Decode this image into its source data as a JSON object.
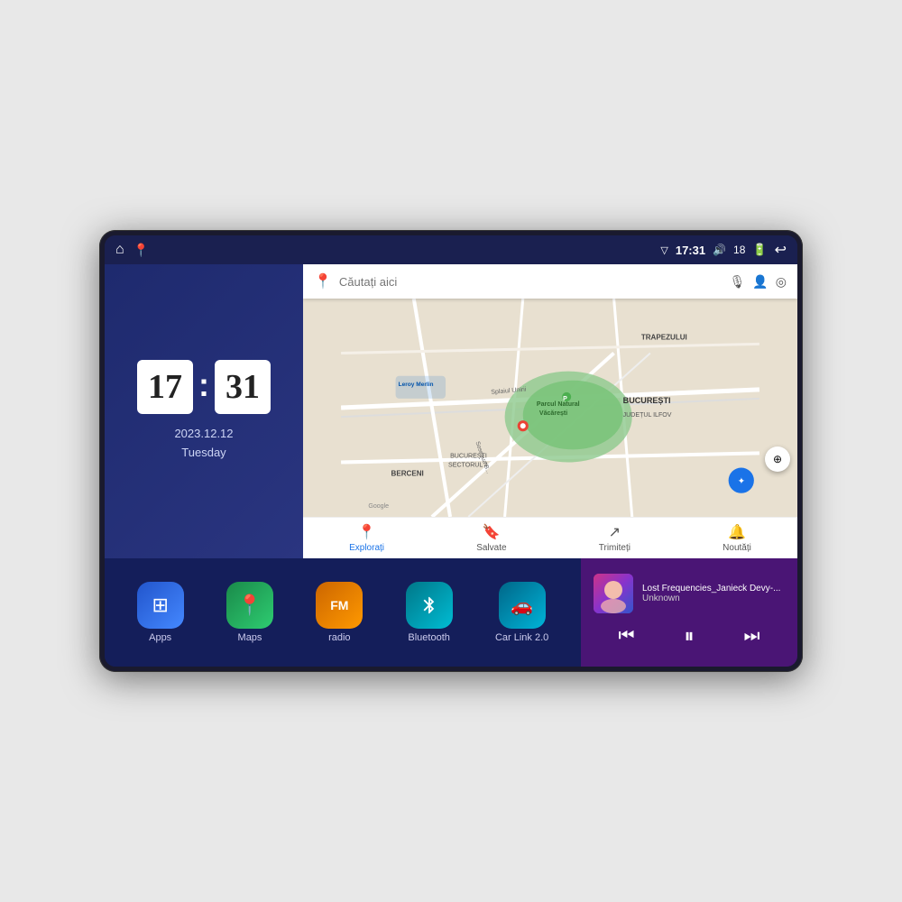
{
  "device": {
    "screen": {
      "status_bar": {
        "left_icons": [
          "home-icon",
          "maps-icon"
        ],
        "time": "17:31",
        "signal_icon": "signal-icon",
        "volume_icon": "volume-icon",
        "volume_level": "18",
        "battery_icon": "battery-icon",
        "back_icon": "back-icon"
      },
      "clock": {
        "hour": "17",
        "minute": "31",
        "date": "2023.12.12",
        "day": "Tuesday"
      },
      "map": {
        "search_placeholder": "Căutați aici",
        "nav_items": [
          {
            "label": "Explorați",
            "active": true
          },
          {
            "label": "Salvate",
            "active": false
          },
          {
            "label": "Trimiteți",
            "active": false
          },
          {
            "label": "Noutăți",
            "active": false
          }
        ],
        "labels": [
          "TRAPEZULUI",
          "BUCUREȘTI",
          "JUDEȚUL ILFOV",
          "BERCENI",
          "Leroy Merlin",
          "Parcul Natural Văcărești",
          "BUCUREȘTI SECTORUL 4",
          "Splaiul Unirii",
          "Google"
        ]
      },
      "apps": [
        {
          "label": "Apps",
          "icon": "grid-icon",
          "color": "blue-grad"
        },
        {
          "label": "Maps",
          "icon": "map-pin-icon",
          "color": "green-grad"
        },
        {
          "label": "radio",
          "icon": "radio-icon",
          "color": "orange-grad"
        },
        {
          "label": "Bluetooth",
          "icon": "bluetooth-icon",
          "color": "teal-grad"
        },
        {
          "label": "Car Link 2.0",
          "icon": "car-icon",
          "color": "cyan-grad"
        }
      ],
      "music": {
        "title": "Lost Frequencies_Janieck Devy-...",
        "artist": "Unknown",
        "controls": {
          "prev": "⏮",
          "play": "⏸",
          "next": "⏭"
        }
      }
    }
  }
}
